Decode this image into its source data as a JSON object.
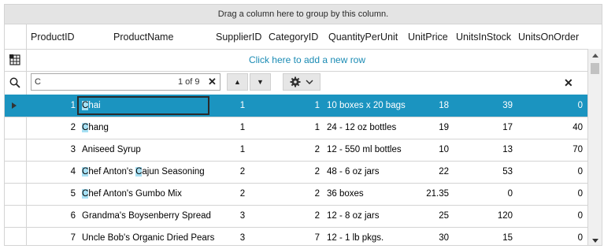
{
  "group_panel": {
    "text": "Drag a column here to group by this column."
  },
  "columns": [
    "ProductID",
    "ProductName",
    "SupplierID",
    "CategoryID",
    "QuantityPerUnit",
    "UnitPrice",
    "UnitsInStock",
    "UnitsOnOrder"
  ],
  "new_row": {
    "text": "Click here to add a new row",
    "icon": "add-row-table-icon"
  },
  "search": {
    "icon": "search-icon",
    "value": "C",
    "match_count": "1 of 9",
    "clear": "✕",
    "prev": "▲",
    "next": "▼",
    "settings_icon": "gear-icon",
    "settings_caret": "chevron-down-icon",
    "close": "✕"
  },
  "rows": [
    {
      "id": "1",
      "name_hl": "C",
      "name_rest": "hai",
      "supplier": "1",
      "category": "1",
      "qty": "10 boxes x 20 bags",
      "price": "18",
      "stock": "39",
      "order": "0",
      "selected": true
    },
    {
      "id": "2",
      "name_hl": "C",
      "name_rest": "hang",
      "supplier": "1",
      "category": "1",
      "qty": "24 - 12 oz bottles",
      "price": "19",
      "stock": "17",
      "order": "40"
    },
    {
      "id": "3",
      "name_plain": "Aniseed Syrup",
      "supplier": "1",
      "category": "2",
      "qty": "12 - 550 ml bottles",
      "price": "10",
      "stock": "13",
      "order": "70"
    },
    {
      "id": "4",
      "name_hl": "C",
      "name_mid": "hef Anton's ",
      "name_hl2": "C",
      "name_rest": "ajun Seasoning",
      "supplier": "2",
      "category": "2",
      "qty": "48 - 6 oz jars",
      "price": "22",
      "stock": "53",
      "order": "0"
    },
    {
      "id": "5",
      "name_hl": "C",
      "name_rest": "hef Anton's Gumbo Mix",
      "supplier": "2",
      "category": "2",
      "qty": "36 boxes",
      "price": "21.35",
      "stock": "0",
      "order": "0"
    },
    {
      "id": "6",
      "name_plain": "Grandma's Boysenberry Spread",
      "supplier": "3",
      "category": "2",
      "qty": "12 - 8 oz jars",
      "price": "25",
      "stock": "120",
      "order": "0"
    },
    {
      "id": "7",
      "name_plain": "Uncle Bob's Organic Dried Pears",
      "supplier": "3",
      "category": "7",
      "qty": "12 - 1 lb pkgs.",
      "price": "30",
      "stock": "15",
      "order": "0"
    }
  ],
  "colors": {
    "selected_row": "#1b94c0",
    "search_highlight": "#a6e0f4",
    "link": "#1a8bb4"
  }
}
